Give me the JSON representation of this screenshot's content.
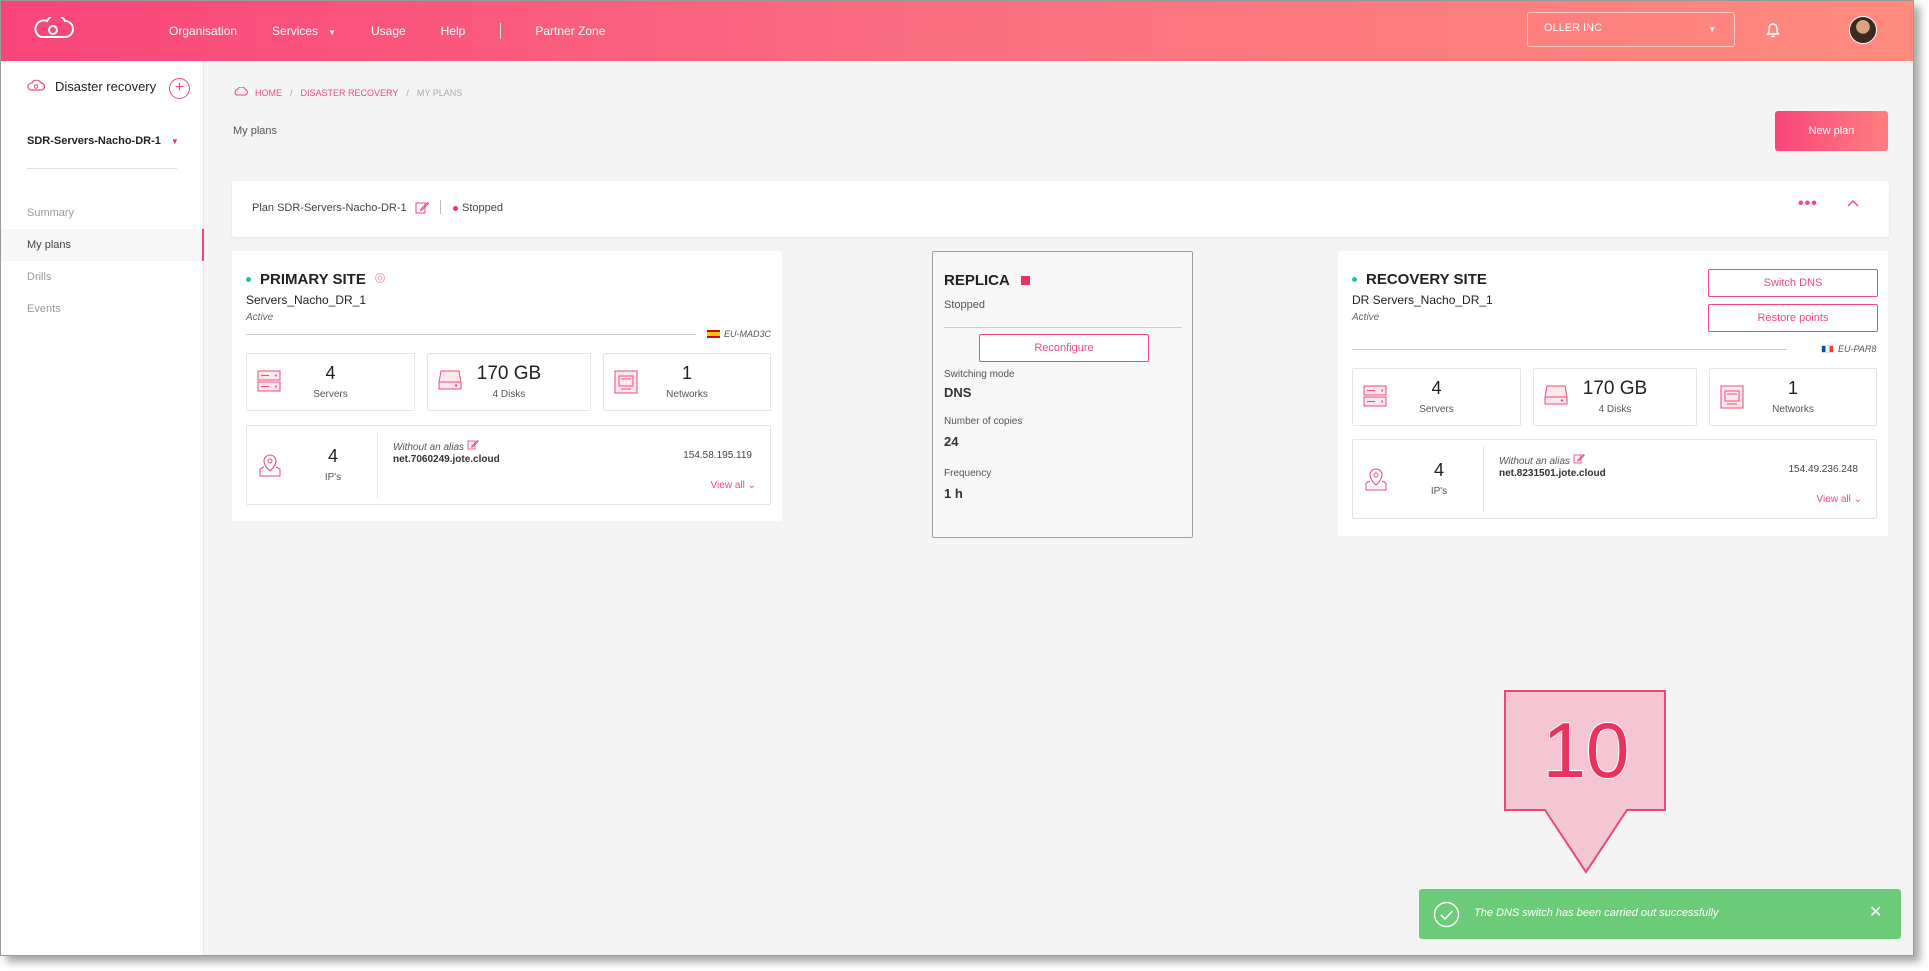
{
  "colors": {
    "accent": "#ef4a78",
    "success": "#6ccb78",
    "status_stopped": "#e8335f",
    "status_active": "#2ec27e"
  },
  "nav": {
    "organisation": "Organisation",
    "services": "Services",
    "usage": "Usage",
    "help": "Help",
    "partner_zone": "Partner Zone"
  },
  "header": {
    "org_selected": "OLLER INC"
  },
  "sidebar": {
    "title": "Disaster recovery",
    "add_icon": "+",
    "plan_selector": "SDR-Servers-Nacho-DR-1",
    "items": [
      "Summary",
      "My plans",
      "Drills",
      "Events"
    ],
    "active_item": "My plans"
  },
  "breadcrumb": {
    "home": "HOME",
    "section": "DISASTER RECOVERY",
    "current": "MY PLANS"
  },
  "page": {
    "title": "My plans",
    "new_plan_label": "New plan"
  },
  "plan": {
    "name": "Plan SDR-Servers-Nacho-DR-1",
    "status": "Stopped",
    "more_icon": "•••",
    "collapse_icon": "^"
  },
  "primary": {
    "heading": "PRIMARY SITE",
    "name": "Servers_Nacho_DR_1",
    "status": "Active",
    "region": "EU-MAD3C",
    "servers": {
      "value": "4",
      "label": "Servers"
    },
    "disks": {
      "value": "170 GB",
      "label": "4 Disks"
    },
    "networks": {
      "value": "1",
      "label": "Networks"
    },
    "ips": {
      "value": "4",
      "label": "IP's"
    },
    "alias": "Without an alias",
    "host": "net.7060249.jote.cloud",
    "ip_address": "154.58.195.119",
    "view_all": "View all"
  },
  "replica": {
    "heading": "REPLICA",
    "status": "Stopped",
    "reconfigure_label": "Reconfigure",
    "switching_mode_label": "Switching mode",
    "switching_mode": "DNS",
    "copies_label": "Number of copies",
    "copies": "24",
    "frequency_label": "Frequency",
    "frequency": "1 h"
  },
  "recovery": {
    "heading": "RECOVERY SITE",
    "name": "DR Servers_Nacho_DR_1",
    "status": "Active",
    "region": "EU-PAR8",
    "switch_dns_label": "Switch DNS",
    "restore_points_label": "Restore points",
    "servers": {
      "value": "4",
      "label": "Servers"
    },
    "disks": {
      "value": "170 GB",
      "label": "4 Disks"
    },
    "networks": {
      "value": "1",
      "label": "Networks"
    },
    "ips": {
      "value": "4",
      "label": "IP's"
    },
    "alias": "Without an alias",
    "host": "net.8231501.jote.cloud",
    "ip_address": "154.49.236.248",
    "view_all": "View all"
  },
  "annotation": {
    "step_number": "10"
  },
  "toast": {
    "message": "The DNS switch has been carried out successfully",
    "close_icon": "✕"
  }
}
